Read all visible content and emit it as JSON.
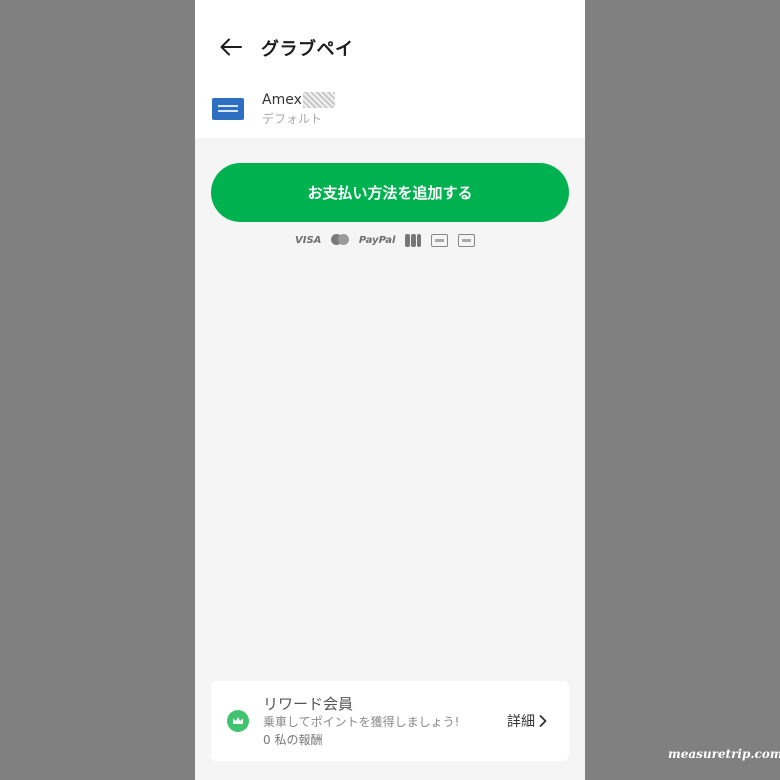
{
  "header": {
    "title": "グラブペイ",
    "back_icon": "arrow-left-icon"
  },
  "payment_method": {
    "card_name": "Amex",
    "card_sub": "デフォルト",
    "logo_icon": "amex-card-icon",
    "logo_color": "#2f6fc2"
  },
  "add_button": {
    "label": "お支払い方法を追加する",
    "color": "#00b14f"
  },
  "accepted_brands": {
    "visa": "VISA",
    "paypal": "PayPal",
    "icons": [
      "mastercard-icon",
      "jcb-icon",
      "card-icon",
      "diners-icon"
    ]
  },
  "rewards": {
    "title": "リワード会員",
    "subtitle": "乗車してポイントを獲得しましょう!",
    "points": "0 私の報酬",
    "detail_label": "詳細",
    "icon": "crown-icon",
    "icon_color": "#3fc36f"
  },
  "watermark": "measuretrip.com"
}
